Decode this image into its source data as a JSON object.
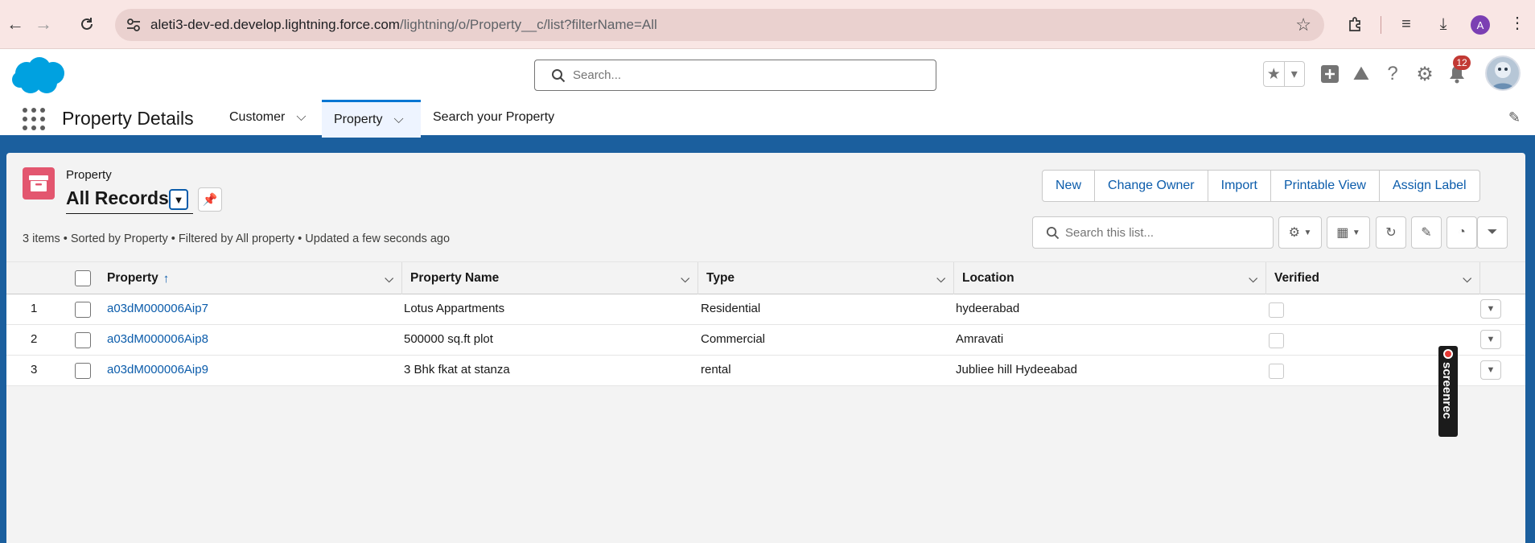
{
  "browser": {
    "url_host": "aleti3-dev-ed.develop.lightning.force.com",
    "url_path": "/lightning/o/Property__c/list?filterName=All",
    "profile_initial": "A"
  },
  "header": {
    "search_placeholder": "Search...",
    "notification_count": "12"
  },
  "app": {
    "name": "Property Details",
    "tabs": [
      {
        "label": "Customer"
      },
      {
        "label": "Property"
      },
      {
        "label": "Search your Property"
      }
    ]
  },
  "listview": {
    "object_label": "Property",
    "title": "All Records",
    "meta": "3 items • Sorted by Property • Filtered by All property • Updated a few seconds ago",
    "actions": [
      "New",
      "Change Owner",
      "Import",
      "Printable View",
      "Assign Label"
    ],
    "search_placeholder": "Search this list..."
  },
  "table": {
    "columns": [
      "Property",
      "Property Name",
      "Type",
      "Location",
      "Verified"
    ],
    "rows": [
      {
        "num": "1",
        "id": "a03dM000006Aip7",
        "name": "Lotus Appartments",
        "type": "Residential",
        "location": "hydeerabad",
        "verified": false
      },
      {
        "num": "2",
        "id": "a03dM000006Aip8",
        "name": "500000 sq.ft plot",
        "type": "Commercial",
        "location": "Amravati",
        "verified": false
      },
      {
        "num": "3",
        "id": "a03dM000006Aip9",
        "name": "3 Bhk fkat at stanza",
        "type": "rental",
        "location": "Jubliee hill Hydeeabad",
        "verified": false
      }
    ]
  },
  "overlay": {
    "screenrec_label": "screenrec"
  },
  "colors": {
    "brand_blue": "#0176d3",
    "band_blue": "#1b5f9e",
    "object_icon": "#e3566f",
    "link": "#0b5cab",
    "badge": "#c23934"
  }
}
